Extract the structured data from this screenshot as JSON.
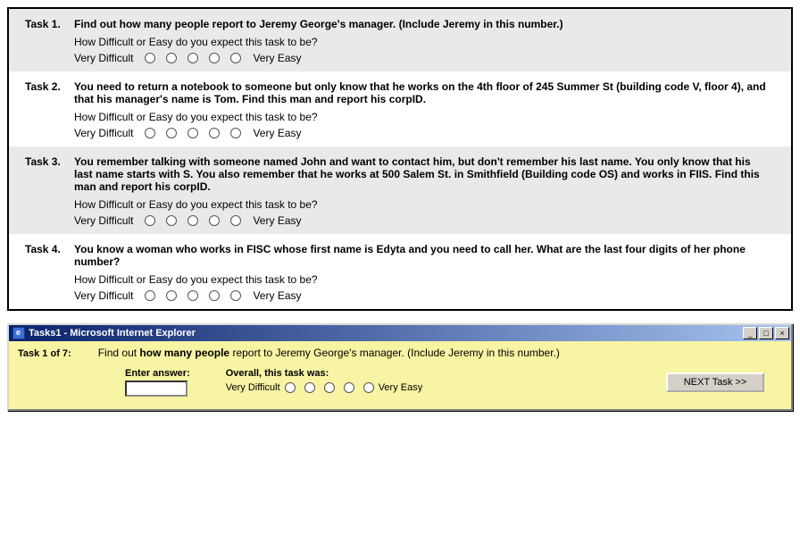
{
  "tasks": [
    {
      "num": "Task 1.",
      "desc": "Find out how many people report to Jeremy George's manager. (Include Jeremy in this number.)",
      "question": "How Difficult or Easy do you expect this task to be?",
      "left": "Very Difficult",
      "right": "Very Easy"
    },
    {
      "num": "Task 2.",
      "desc": "You need to return a notebook to someone but only know that he works on the 4th floor of 245 Summer St (building code V, floor 4), and that his manager's name is Tom. Find this man and report his corpID.",
      "question": "How Difficult or Easy do you expect this task to be?",
      "left": "Very Difficult",
      "right": "Very Easy"
    },
    {
      "num": "Task 3.",
      "desc": "You remember talking with someone named John and want to contact him, but don't remember his last name. You only know that his last name starts with S. You also remember that he works at 500 Salem St. in Smithfield (Building code OS) and works in FIIS. Find this man and report his corpID.",
      "question": "How Difficult or Easy do you expect this task to be?",
      "left": "Very Difficult",
      "right": "Very Easy"
    },
    {
      "num": "Task 4.",
      "desc": "You know a woman who works in FISC whose first name is Edyta and you need to call her. What are the last four digits of her phone number?",
      "question": "How Difficult or Easy do you expect this task to be?",
      "left": "Very Difficult",
      "right": "Very Easy"
    }
  ],
  "window": {
    "title": "Tasks1 - Microsoft Internet Explorer",
    "page_label": "Task 1 of 7:",
    "prompt_pre": "Find out ",
    "prompt_bold": "how many people",
    "prompt_post": " report to Jeremy George's manager. (Include Jeremy in this number.)",
    "answer_label": "Enter answer:",
    "overall_label": "Overall, this task was:",
    "left": "Very Difficult",
    "right": "Very Easy",
    "next": "NEXT Task >>",
    "btn_min": "_",
    "btn_max": "□",
    "btn_close": "×"
  }
}
